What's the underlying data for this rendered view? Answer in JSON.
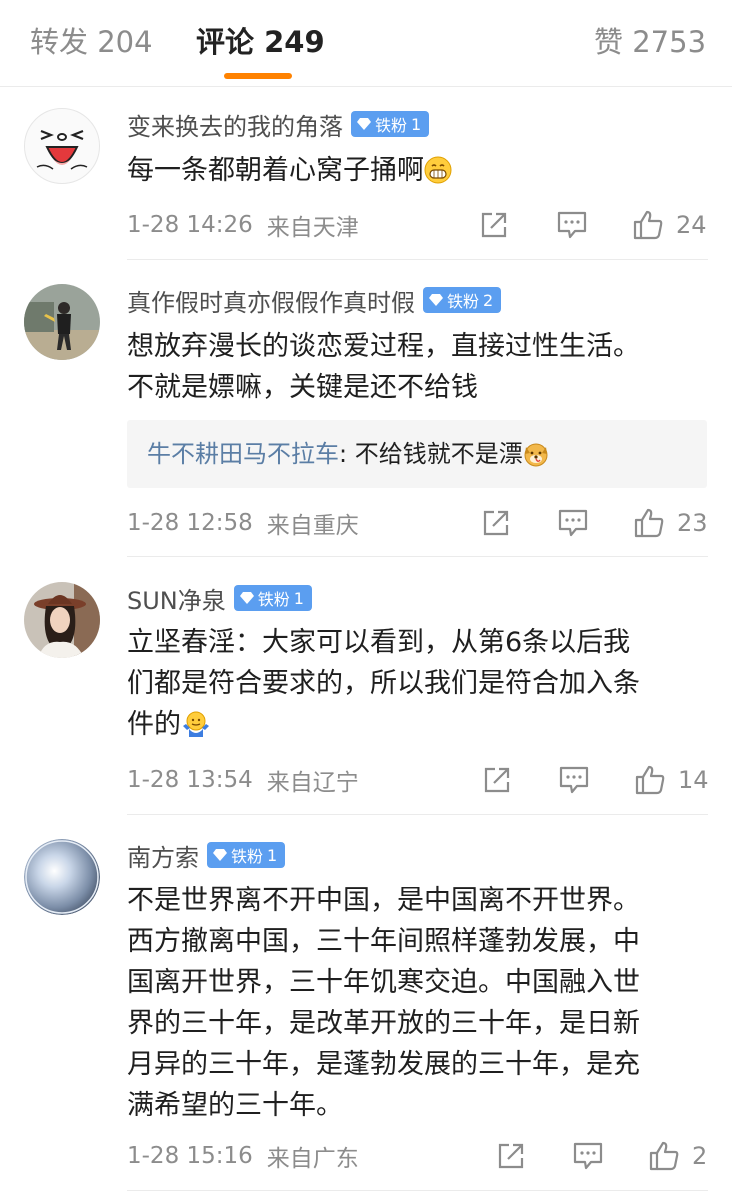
{
  "tabs": {
    "repost_label": "转发",
    "repost_count": "204",
    "comment_label": "评论",
    "comment_count": "249",
    "like_label": "赞",
    "like_count": "2753"
  },
  "badge_prefix": "铁粉",
  "comments": [
    {
      "username": "变来换去的我的角落",
      "badge_level": "1",
      "text": "每一条都朝着心窝子捅啊",
      "emoji": "grinning-emoji",
      "time": "1-28 14:26",
      "location": "来自天津",
      "likes": "24"
    },
    {
      "username": "真作假时真亦假假作真时假",
      "badge_level": "2",
      "text_lines": [
        "想放弃漫长的谈恋爱过程，直接过性生活。",
        "不就是嫖嘛，关键是还不给钱"
      ],
      "reply_user": "牛不耕田马不拉车",
      "reply_sep": ": ",
      "reply_text": "不给钱就不是漂",
      "reply_emoji": "dog-emoji",
      "time": "1-28 12:58",
      "location": "来自重庆",
      "likes": "23"
    },
    {
      "username": "SUN净泉",
      "badge_level": "1",
      "text_lines": [
        "立坚春淫：大家可以看到，从第6条以后我",
        "们都是符合要求的，所以我们是符合加入条",
        "件的"
      ],
      "emoji": "shrug-emoji",
      "time": "1-28 13:54",
      "location": "来自辽宁",
      "likes": "14"
    },
    {
      "username": "南方索",
      "badge_level": "1",
      "text_lines": [
        "不是世界离不开中国，是中国离不开世界。",
        "西方撤离中国，三十年间照样蓬勃发展，中",
        "国离开世界，三十年饥寒交迫。中国融入世",
        "界的三十年，是改革开放的三十年，是日新",
        "月异的三十年，是蓬勃发展的三十年，是充",
        "满希望的三十年。"
      ],
      "time": "1-28 15:16",
      "location": "来自广东",
      "likes": "2"
    }
  ],
  "colors": {
    "accent": "#ff8200",
    "badge": "#5b9ef0",
    "reply_user": "#5b7ea5",
    "meta_gray": "#8c8c8c"
  }
}
